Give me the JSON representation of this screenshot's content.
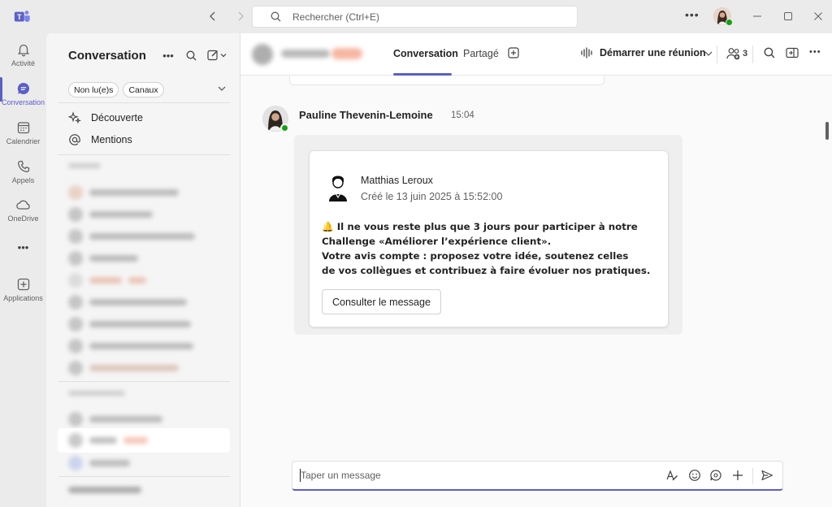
{
  "titlebar": {
    "search_placeholder": "Rechercher (Ctrl+E)",
    "more_icon": "more-horizontal-icon",
    "window_controls": [
      "minimize-icon",
      "maximize-icon",
      "close-icon"
    ]
  },
  "rail": {
    "items": [
      {
        "label": "Activité",
        "icon": "bell-icon"
      },
      {
        "label": "Conversation",
        "icon": "chat-icon",
        "active": true
      },
      {
        "label": "Calendrier",
        "icon": "calendar-icon"
      },
      {
        "label": "Appels",
        "icon": "phone-icon"
      },
      {
        "label": "OneDrive",
        "icon": "cloud-icon"
      },
      {
        "label": "Applications",
        "icon": "add-app-icon"
      }
    ],
    "more_label": "•••"
  },
  "list": {
    "title": "Conversation",
    "filters": [
      "Non lu(e)s",
      "Canaux"
    ],
    "links": [
      {
        "label": "Découverte",
        "icon": "sparkle-icon"
      },
      {
        "label": "Mentions",
        "icon": "at-icon"
      }
    ]
  },
  "chat": {
    "tabs": [
      {
        "label": "Conversation",
        "active": true
      },
      {
        "label": "Partagé"
      }
    ],
    "meeting_label": "Démarrer une réunion",
    "participants_count": "3",
    "message": {
      "author": "Pauline Thevenin-Lemoine",
      "time": "15:04",
      "card": {
        "author": "Matthias Leroux",
        "created": "Créé le 13 juin 2025 à 15:52:00",
        "lines": [
          "🔔 Il ne vous reste plus que 3 jours pour participer à notre",
          " Challenge «Améliorer l’expérience client».",
          "Votre avis compte : proposez votre idée, soutenez celles",
          "de vos collègues et contribuez à faire évoluer nos pratiques."
        ],
        "button_label": "Consulter le message"
      }
    },
    "compose_placeholder": "Taper un message"
  },
  "colors": {
    "accent": "#5b5fc7",
    "presence": "#13a10e"
  }
}
